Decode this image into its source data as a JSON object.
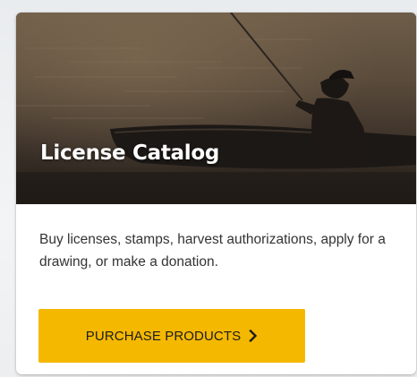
{
  "card": {
    "title": "License Catalog",
    "description": "Buy licenses, stamps, harvest authorizations, apply for a drawing, or make a donation.",
    "button_label": "PURCHASE PRODUCTS",
    "button_icon": "chevron-right-icon",
    "hero_image": "fisherman-in-boat-at-sunset"
  },
  "colors": {
    "button_bg": "#f5b800",
    "button_text": "#1d1d1d",
    "title_text": "#ffffff",
    "body_text": "#333333",
    "card_bg": "#ffffff"
  }
}
